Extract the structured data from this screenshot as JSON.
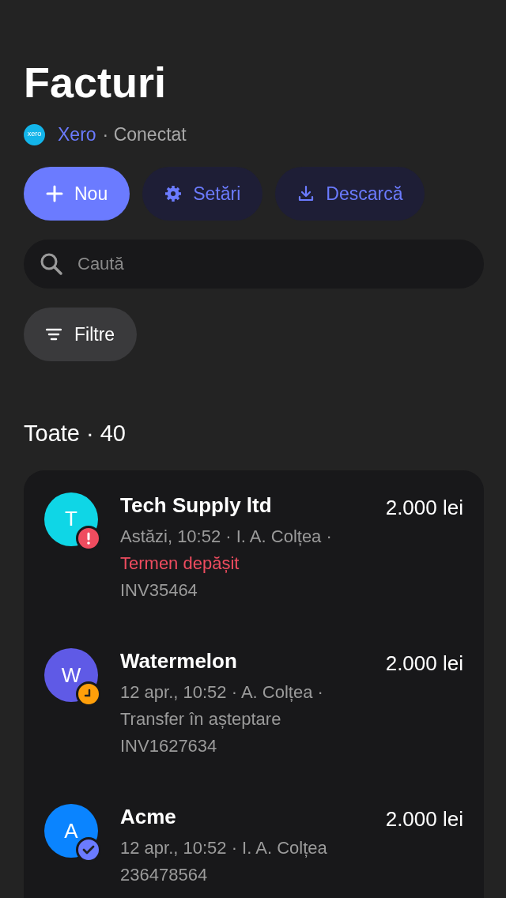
{
  "title": "Facturi",
  "connection": {
    "logo_text": "xero",
    "service": "Xero",
    "status": "· Conectat"
  },
  "actions": [
    {
      "kind": "add",
      "label": "Nou",
      "primary": true
    },
    {
      "kind": "settings",
      "label": "Setări",
      "primary": false
    },
    {
      "kind": "download",
      "label": "Descarcă",
      "primary": false
    }
  ],
  "search": {
    "placeholder": "Caută"
  },
  "filter": {
    "label": "Filtre"
  },
  "section": {
    "title": "Toate · 40"
  },
  "invoices": [
    {
      "initial": "T",
      "color": "#0fd6e6",
      "name": "Tech Supply ltd",
      "amount": "2.000 lei",
      "meta": "Astăzi, 10:52 · I. A. Colțea ·",
      "kind": "overdue",
      "status_text": "Termen depășit",
      "number": "INV35464"
    },
    {
      "initial": "W",
      "color": "#5f5ae6",
      "name": "Watermelon",
      "amount": "2.000 lei",
      "meta": "12 apr., 10:52 · A. Colțea ·",
      "kind": "pending",
      "status_text": "Transfer în așteptare",
      "number": "INV1627634"
    },
    {
      "initial": "A",
      "color": "#0a84ff",
      "name": "Acme",
      "amount": "2.000 lei",
      "meta": "12 apr., 10:52 · I. A. Colțea",
      "kind": "paid",
      "number": "236478564"
    }
  ]
}
